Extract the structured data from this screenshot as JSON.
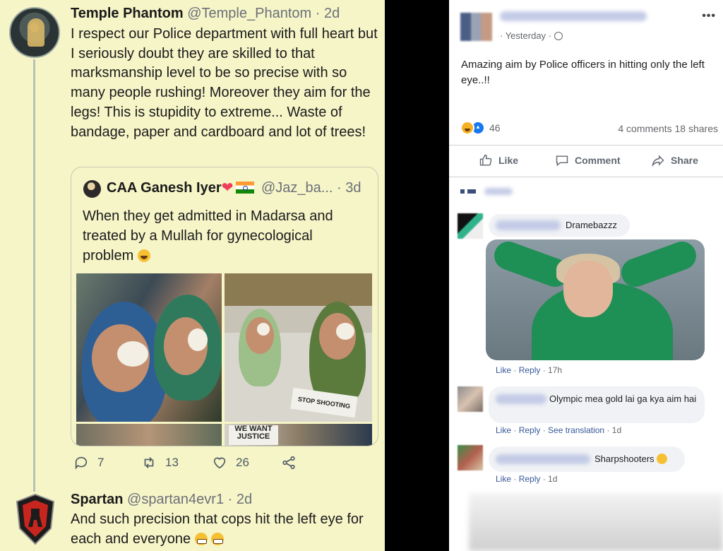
{
  "tweet": {
    "author_name": "Temple Phantom",
    "author_handle": "@Temple_Phantom",
    "time": "· 2d",
    "text": "I respect our Police department with full heart but I seriously doubt they are skilled to that marksmanship level to be so precise with so many people rushing! Moreover they aim for the legs! This is stupidity to extreme... Waste of bandage, paper and cardboard and lot of trees!",
    "quote": {
      "author_name": "CAA Ganesh Iyer",
      "author_handle": "@Jaz_ba...",
      "time": "· 3d",
      "text": "When they get admitted in Madarsa and treated by a Mullah for gynecological problem",
      "sign_text_1": "STOP SHOOTING",
      "sign_text_2": "WE WANT JUSTICE"
    },
    "actions": {
      "replies": "7",
      "retweets": "13",
      "likes": "26"
    }
  },
  "reply": {
    "author_name": "Spartan",
    "author_handle": "@spartan4evr1",
    "time": "· 2d",
    "text": "And such precision that cops hit the left eye for each and everyone"
  },
  "facebook": {
    "post_time": "· Yesterday ·",
    "post_text": "Amazing aim by Police officers in hitting only the left eye..!!",
    "more_icon": "•••",
    "reaction_count": "46",
    "comments_count": "4 comments",
    "shares_count": "18 shares",
    "actions": {
      "like": "Like",
      "comment": "Comment",
      "share": "Share"
    },
    "comments": [
      {
        "text": "Dramebazzz",
        "meta_like": "Like",
        "meta_reply": "Reply",
        "meta_time": "· 17h"
      },
      {
        "text": "Olympic mea gold lai ga kya aim hai",
        "meta_like": "Like",
        "meta_reply": "Reply",
        "meta_translate": "See translation",
        "meta_time": "· 1d"
      },
      {
        "text": "Sharpshooters",
        "meta_like": "Like",
        "meta_reply": "Reply",
        "meta_time": "· 1d"
      }
    ]
  },
  "colors": {
    "tweet_bg": "#f6f5c8",
    "fb_bg": "#ffffff",
    "fb_blue": "#1877f2",
    "gutter": "#000000"
  }
}
